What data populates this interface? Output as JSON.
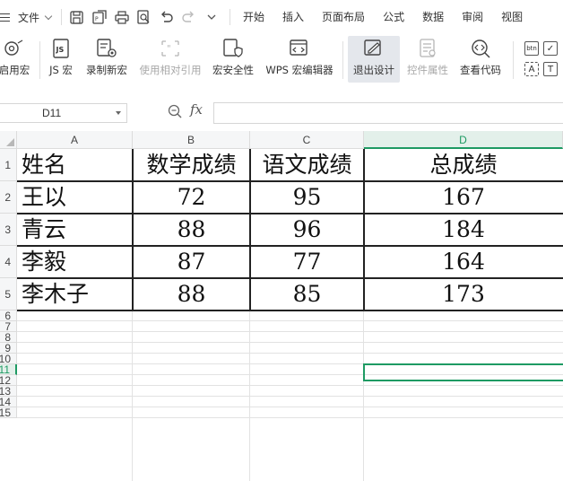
{
  "menu": {
    "file_label": "文件",
    "tabs": [
      "开始",
      "插入",
      "页面布局",
      "公式",
      "数据",
      "审阅",
      "视图"
    ]
  },
  "quick_access_icons": [
    "save-icon",
    "export-icon",
    "print-icon",
    "print-preview-icon",
    "undo-icon",
    "redo-icon",
    "customize-dropdown-icon"
  ],
  "ribbon": {
    "buttons": [
      {
        "label": "启用宏",
        "icon": "macro-enable-icon",
        "enabled": true
      },
      {
        "label": "JS 宏",
        "icon": "js-macro-icon",
        "enabled": true
      },
      {
        "label": "录制新宏",
        "icon": "record-macro-icon",
        "enabled": true
      },
      {
        "label": "使用相对引用",
        "icon": "relative-reference-icon",
        "enabled": false
      },
      {
        "label": "宏安全性",
        "icon": "macro-security-icon",
        "enabled": true
      },
      {
        "label": "WPS 宏编辑器",
        "icon": "macro-editor-icon",
        "enabled": true
      },
      {
        "label": "退出设计",
        "icon": "exit-design-icon",
        "enabled": true
      },
      {
        "label": "控件属性",
        "icon": "control-properties-icon",
        "enabled": false
      },
      {
        "label": "查看代码",
        "icon": "view-code-icon",
        "enabled": true
      }
    ],
    "small_controls": {
      "button": "btn",
      "checkbox": "✓",
      "label": "A",
      "textbox": "T"
    }
  },
  "formula_bar": {
    "name_box": "D11",
    "fx_label": "fx",
    "formula": ""
  },
  "sheet": {
    "columns": [
      "A",
      "B",
      "C",
      "D"
    ],
    "selected_column": "D",
    "row_numbers": [
      "1",
      "2",
      "3",
      "4",
      "5",
      "6",
      "7",
      "8",
      "9",
      "10",
      "11",
      "12",
      "13",
      "14",
      "15"
    ],
    "selected_row": "11",
    "header_row": [
      "姓名",
      "数学成绩",
      "语文成绩",
      "总成绩"
    ],
    "rows": [
      [
        "王以",
        "72",
        "95",
        "167"
      ],
      [
        "青云",
        "88",
        "96",
        "184"
      ],
      [
        "李毅",
        "87",
        "77",
        "164"
      ],
      [
        "李木子",
        "88",
        "85",
        "173"
      ]
    ],
    "active_cell": "D11"
  },
  "colors": {
    "accent_green": "#1e9a63",
    "header_bg": "#f5f6f7",
    "grid_line": "#e2e2e2"
  }
}
